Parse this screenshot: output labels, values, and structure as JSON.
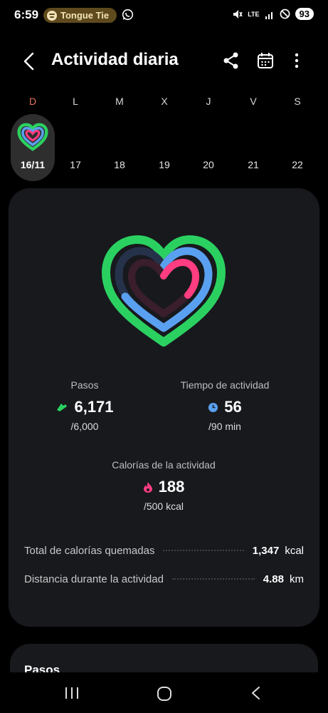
{
  "status_bar": {
    "time": "6:59",
    "media_app_icon": "spotify-icon",
    "media_title": "Tongue Tie",
    "notification_icon": "whatsapp-icon",
    "network": "LTE",
    "battery": "93"
  },
  "header": {
    "title": "Actividad diaria",
    "icons": [
      "back-icon",
      "share-icon",
      "calendar-icon",
      "more-icon"
    ]
  },
  "week": {
    "days": [
      {
        "letter": "D",
        "number": "16/11",
        "selected": true
      },
      {
        "letter": "L",
        "number": "17"
      },
      {
        "letter": "M",
        "number": "18"
      },
      {
        "letter": "X",
        "number": "19"
      },
      {
        "letter": "J",
        "number": "20"
      },
      {
        "letter": "V",
        "number": "21"
      },
      {
        "letter": "S",
        "number": "22"
      }
    ]
  },
  "activity": {
    "steps": {
      "label": "Pasos",
      "value": "6,171",
      "goal": "/6,000",
      "progress": 1.03
    },
    "active_time": {
      "label": "Tiempo de actividad",
      "value": "56",
      "goal": "/90 min",
      "progress": 0.62
    },
    "calories": {
      "label": "Calorías de la actividad",
      "value": "188",
      "goal": "/500 kcal",
      "progress": 0.38
    }
  },
  "summary": {
    "total_calories": {
      "label": "Total de calorías quemadas",
      "value": "1,347",
      "unit": "kcal"
    },
    "distance": {
      "label": "Distancia durante la actividad",
      "value": "4.88",
      "unit": "km"
    }
  },
  "next_card": {
    "title": "Pasos"
  },
  "colors": {
    "steps": "#2bd160",
    "active_time": "#5aa0f0",
    "calories": "#ff3d80",
    "sunday": "#e5735e",
    "card": "#17191d"
  }
}
